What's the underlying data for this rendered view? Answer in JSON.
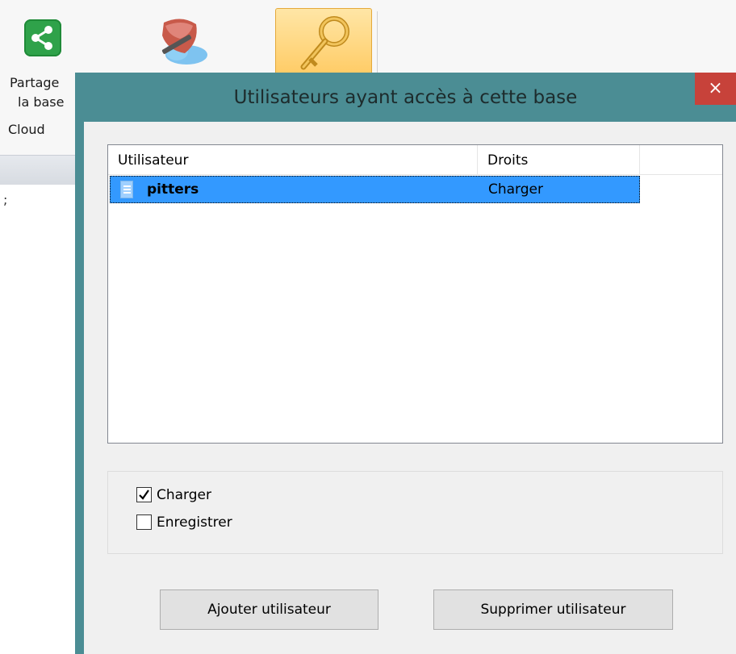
{
  "ribbon": {
    "share_label_line1": "Partage",
    "share_label_line2": "la base",
    "group_label": "Cloud",
    "share_icon": "share-icon",
    "cloud_icon": "cloud-user-icon",
    "key_icon": "key-icon"
  },
  "background": {
    "left_glyph": ";"
  },
  "dialog": {
    "title": "Utilisateurs ayant accès à cette base",
    "close_label": "×",
    "list": {
      "columns": [
        "Utilisateur",
        "Droits"
      ],
      "rows": [
        {
          "user": "pitters",
          "rights": "Charger",
          "selected": true
        }
      ]
    },
    "permissions": [
      {
        "label": "Charger",
        "checked": true
      },
      {
        "label": "Enregistrer",
        "checked": false
      }
    ],
    "buttons": {
      "add": "Ajouter utilisateur",
      "remove": "Supprimer utilisateur"
    }
  },
  "colors": {
    "dialog_frame": "#4b8d94",
    "close_button": "#c7423a",
    "selection": "#3399ff",
    "active_ribbon": "#ffca62"
  }
}
